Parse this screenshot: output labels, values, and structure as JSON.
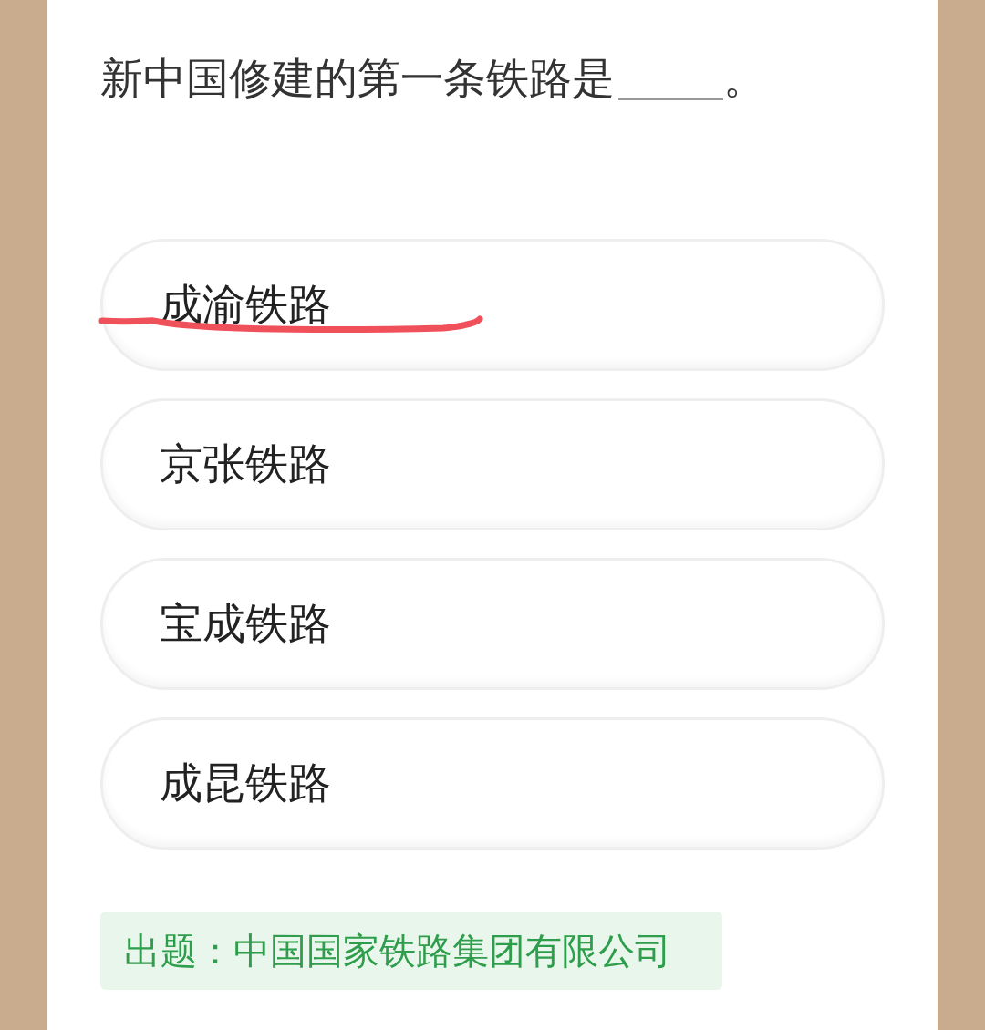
{
  "question": {
    "text": "新中国修建的第一条铁路是",
    "end": "。"
  },
  "options": [
    {
      "label": "成渝铁路",
      "underlined": true
    },
    {
      "label": "京张铁路",
      "underlined": false
    },
    {
      "label": "宝成铁路",
      "underlined": false
    },
    {
      "label": "成昆铁路",
      "underlined": false
    }
  ],
  "source": "出题：中国国家铁路集团有限公司"
}
